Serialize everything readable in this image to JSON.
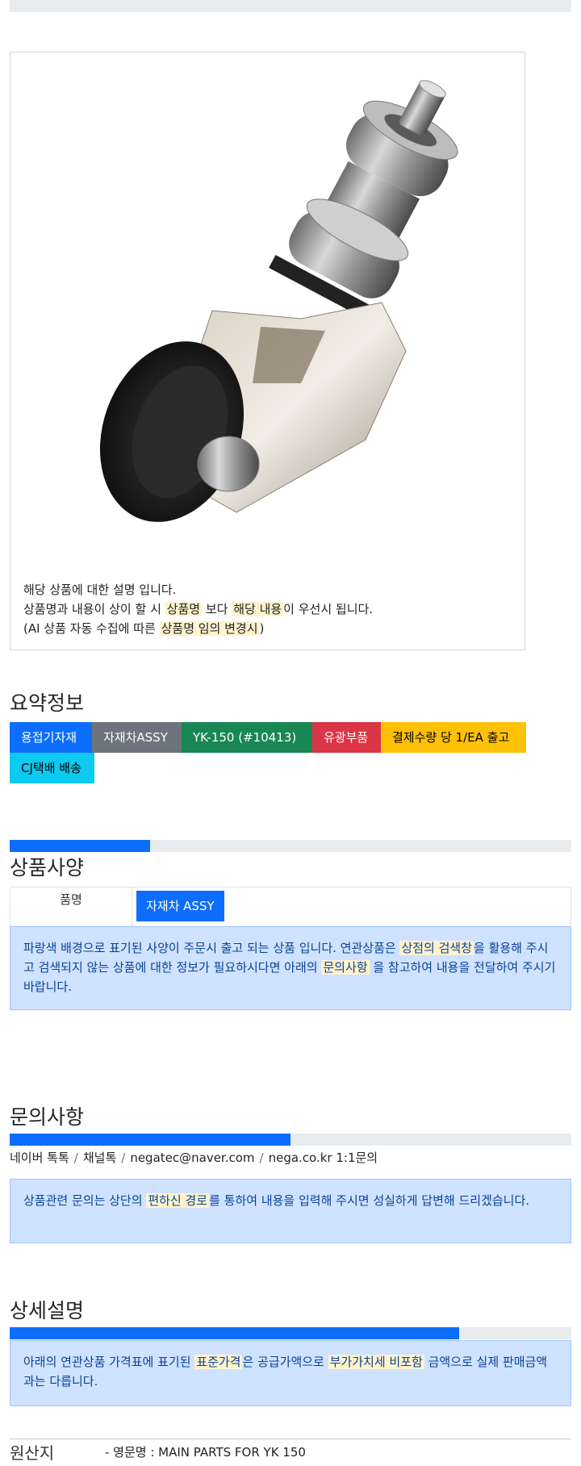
{
  "product": {
    "caption_lines": [
      {
        "parts": [
          "해당 상품에 대한 설명 입니다."
        ]
      },
      {
        "parts": [
          "상품명과 내용이 상이 할 시 ",
          "상품명",
          " 보다 ",
          "해당 내용",
          "이 우선시 됩니다."
        ]
      },
      {
        "parts": [
          "(AI 상품 자동 수집에 따른 ",
          "상품명 임의 변경시",
          ")"
        ]
      }
    ]
  },
  "summary": {
    "title": "요약정보",
    "tags": [
      {
        "label": "용접기자재",
        "color": "#0d6efd"
      },
      {
        "label": "자재차ASSY",
        "color": "#6c757d"
      },
      {
        "label": "YK-150 (#10413)",
        "color": "#198754"
      },
      {
        "label": "유광부품",
        "color": "#dc3545"
      },
      {
        "label": "결제수량 당 1/EA 출고",
        "color": "#ffc107"
      },
      {
        "label": "CJ택배 배송",
        "color": "#0dcaf0"
      }
    ]
  },
  "spec": {
    "title": "상품사양",
    "progress": 0.25,
    "row_label": "품명",
    "row_value": "자재차 ASSY",
    "notice": [
      "파랑색 배경으로 표기된 사양이 주문시 출고 되는 상품 입니다. 연관상품은 ",
      "상점의 검색창",
      "을 활용해 주시고 검색되지 않는 상품에 대한 정보가 필요하시다면 아래의 ",
      "문의사항",
      " 을 참고하여 내용을 전달하여 주시기 바랍니다."
    ]
  },
  "inquiry": {
    "title": "문의사항",
    "progress": 0.5,
    "channels": [
      "네이버 톡톡",
      "채널톡",
      "negatec@naver.com",
      "nega.co.kr 1:1문의"
    ],
    "notice": [
      "상품관련 문의는 상단의 ",
      "편하신 경로",
      "를 통하여 내용을 입력해 주시면 성실하게 답변해 드리겠습니다."
    ]
  },
  "detail": {
    "title": "상세설명",
    "progress": 0.8,
    "notice": [
      "아래의 연관상품 가격표에 표기된 ",
      "표준가격",
      "은 공급가액으로 ",
      "부가가치세 비포함",
      " 금액으로 실제 판매금액과는 다릅니다."
    ]
  },
  "origin": {
    "title": "원산지",
    "text": "- 영문명 : MAIN PARTS FOR YK 150"
  }
}
